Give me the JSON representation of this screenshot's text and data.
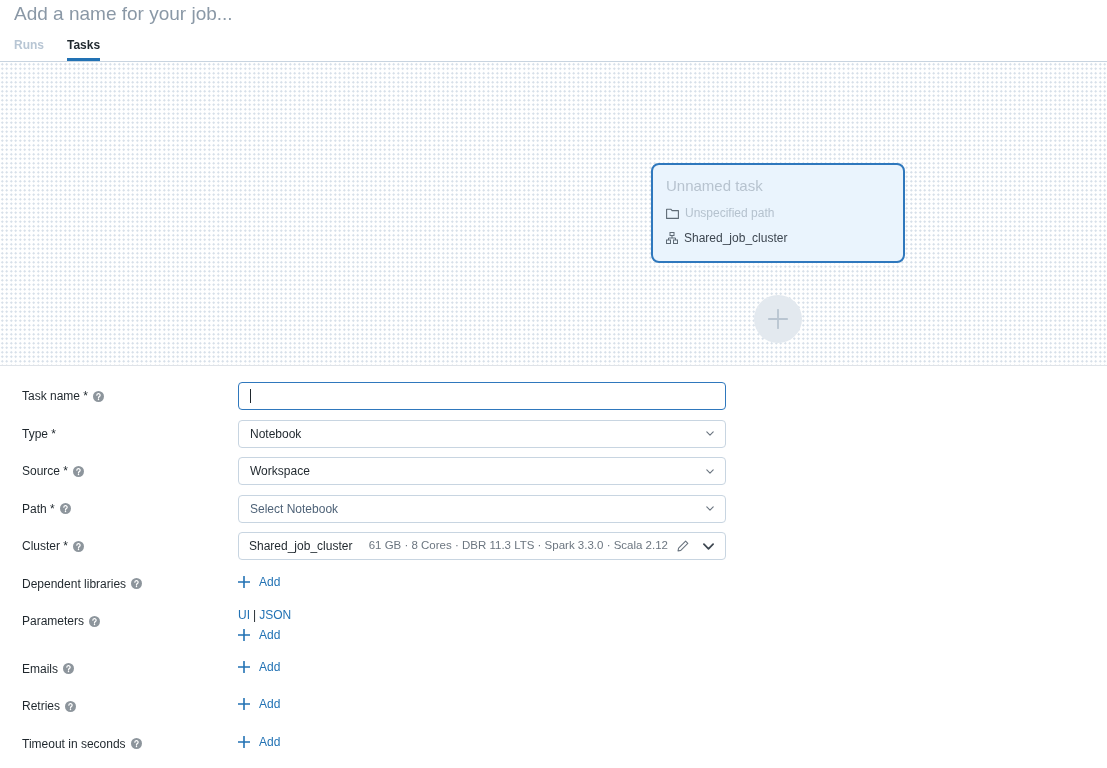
{
  "job": {
    "placeholder": "Add a name for your job..."
  },
  "tabs": [
    {
      "label": "Runs",
      "selected": false,
      "disabled": true
    },
    {
      "label": "Tasks",
      "selected": true,
      "disabled": false
    }
  ],
  "canvas": {
    "tasks": [
      {
        "title": "Unnamed task",
        "named": false,
        "selected": true,
        "details": [
          {
            "kind": "path",
            "text": "Unspecified path",
            "unset": true
          },
          {
            "kind": "cluster",
            "text": "Shared_job_cluster",
            "unset": false
          }
        ]
      }
    ]
  },
  "form": {
    "fields": [
      {
        "kind": "text",
        "label": "Task name *",
        "help": true,
        "focused": true
      },
      {
        "kind": "select",
        "label": "Type *",
        "help": false,
        "focused": false,
        "value": "Notebook"
      },
      {
        "kind": "select",
        "label": "Source *",
        "help": true,
        "focused": false,
        "value": "Workspace"
      },
      {
        "kind": "select",
        "label": "Path *",
        "help": true,
        "focused": false,
        "placeholder": "Select Notebook"
      },
      {
        "kind": "cluster",
        "label": "Cluster *",
        "help": true,
        "focused": false,
        "value": "Shared_job_cluster",
        "details": "61 GB · 8 Cores · DBR 11.3 LTS · Spark 3.3.0 · Scala 2.12"
      },
      {
        "kind": "add",
        "label": "Dependent libraries",
        "help": true,
        "action": "Add"
      },
      {
        "kind": "params",
        "label": "Parameters",
        "help": true,
        "modes": [
          "UI",
          "JSON"
        ],
        "separator": "|",
        "action": "Add"
      },
      {
        "kind": "add",
        "label": "Emails",
        "help": true,
        "action": "Add"
      },
      {
        "kind": "add",
        "label": "Retries",
        "help": true,
        "action": "Add"
      },
      {
        "kind": "add",
        "label": "Timeout in seconds",
        "help": true,
        "action": "Add"
      }
    ]
  }
}
